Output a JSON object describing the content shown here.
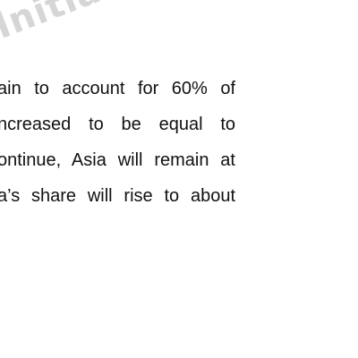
{
  "watermark": {
    "text": "Initiative"
  },
  "document": {
    "lines": [
      "ain to account for 60% of",
      "ncreased to be equal to",
      "ontinue, Asia will remain at",
      "a’s share will rise to about"
    ]
  },
  "colors": {
    "background": "#ffffff",
    "text": "#111111",
    "watermark": "#d6d6d6"
  }
}
